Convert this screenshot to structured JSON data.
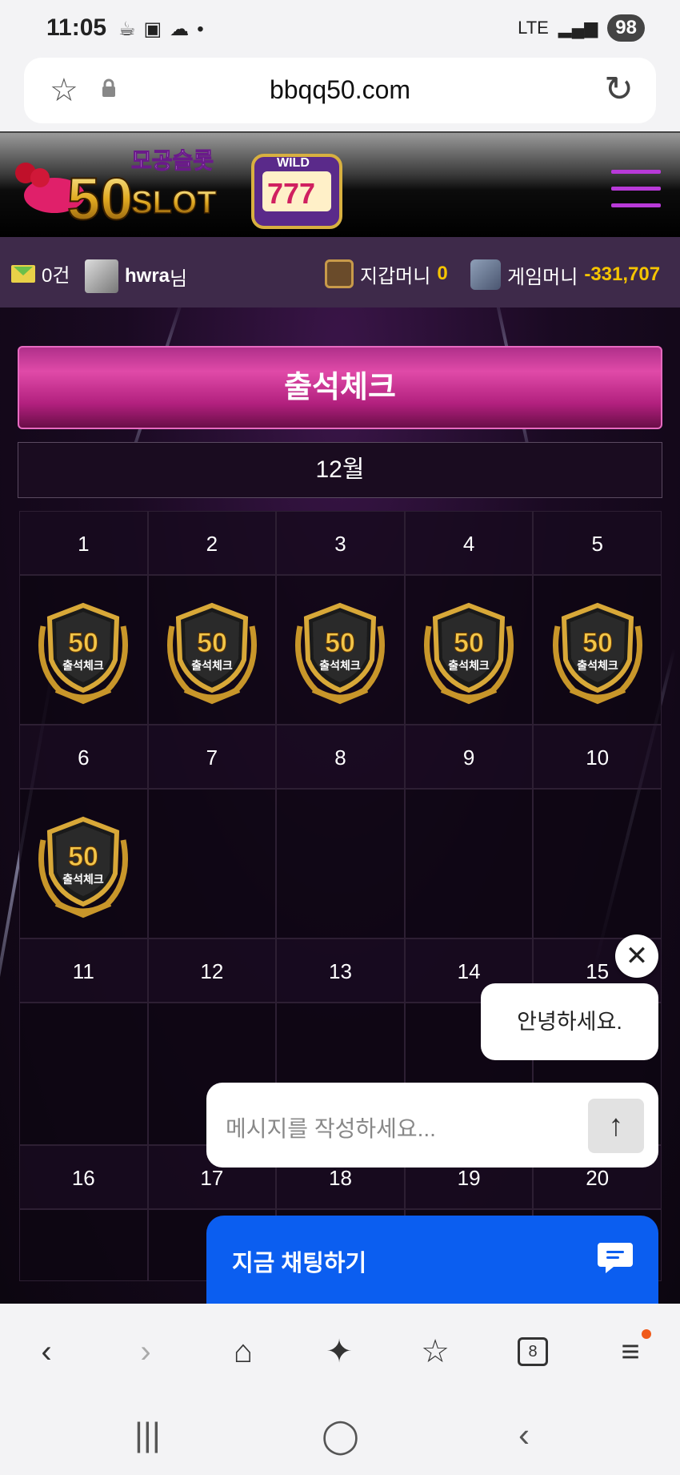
{
  "status_bar": {
    "time": "11:05",
    "network": "LTE",
    "battery": "98"
  },
  "browser": {
    "url": "bbqq50.com"
  },
  "site": {
    "logo_text": "50SLOT",
    "logo_sub": "모공슬롯",
    "user_bar": {
      "mail_count": "0건",
      "username": "hwra",
      "username_suffix": "님",
      "wallet_label": "지갑머니",
      "wallet_value": "0",
      "game_label": "게임머니",
      "game_value": "-331,707"
    },
    "page_title": "출석체크",
    "month": "12월",
    "badge_number": "50",
    "badge_text": "출석체크",
    "weeks": [
      {
        "days": [
          "1",
          "2",
          "3",
          "4",
          "5"
        ]
      },
      {
        "days": [
          "6",
          "7",
          "8",
          "9",
          "10"
        ]
      },
      {
        "days": [
          "11",
          "12",
          "13",
          "14",
          "15"
        ]
      },
      {
        "days": [
          "16",
          "17",
          "18",
          "19",
          "20"
        ]
      }
    ]
  },
  "chat": {
    "greeting": "안녕하세요.",
    "input_placeholder": "메시지를 작성하세요...",
    "chat_now_label": "지금 채팅하기"
  },
  "browser_nav": {
    "tab_count": "8"
  },
  "colors": {
    "accent_pink": "#c4308e",
    "gold": "#f5c400",
    "chat_blue": "#0b5ef0"
  }
}
